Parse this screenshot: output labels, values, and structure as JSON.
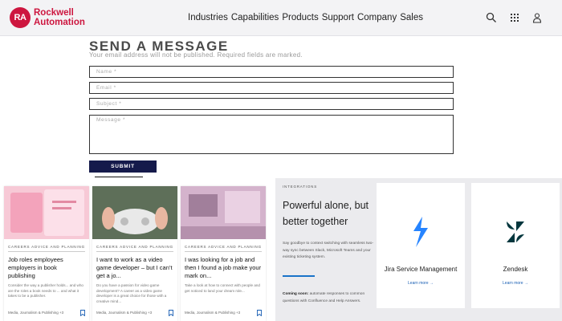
{
  "header": {
    "logo_mark": "RA",
    "logo_line1": "Rockwell",
    "logo_line2": "Automation",
    "nav": [
      "Industries",
      "Capabilities",
      "Products",
      "Support",
      "Company",
      "Sales"
    ],
    "icons": [
      "search-icon",
      "apps-grid-icon",
      "user-icon"
    ]
  },
  "form": {
    "title": "SEND A MESSAGE",
    "note": "Your email address will not be published. Required fields are marked.",
    "name_placeholder": "Name *",
    "email_placeholder": "Email *",
    "subject_placeholder": "Subject *",
    "message_placeholder": "Message *",
    "submit_label": "SUBMIT"
  },
  "cards": [
    {
      "category": "CAREERS ADVICE AND PLANNING",
      "title": "Job roles employees employers in book publishing",
      "desc": "Consider the way a publisher holds... and who are the roles a book needs to ... and what it takes to be a publisher.",
      "meta": "Media, Journalism & Publishing +3",
      "thumb_color": "#f4b6c8"
    },
    {
      "category": "CAREERS ADVICE AND PLANNING",
      "title": "I want to work as a video game developer – but I can’t get a jo...",
      "desc": "Do you have a passion for video game development? A career as a video game developer is a great choice for those with a creative mind...",
      "meta": "Media, Journalism & Publishing +3",
      "thumb_color": "#2a8a3a"
    },
    {
      "category": "CAREERS ADVICE AND PLANNING",
      "title": "I was looking for a job and then I found a job make your mark on...",
      "desc": "Take a look at how to connect with people and get noticed to land your dream role...",
      "meta": "Media, Journalism & Publishing +3",
      "thumb_color": "#c9a4c0"
    }
  ],
  "integrations": {
    "label": "INTEGRATIONS",
    "title": "Powerful alone, but better together",
    "desc": "Say goodbye to context switching with seamless two-way sync between Slack, Microsoft Teams and your existing ticketing system.",
    "coming_bold": "Coming soon:",
    "coming_rest": " automate responses to common questions with Confluence and Help Answers.",
    "items": [
      {
        "name": "Jira Service Management",
        "link": "Learn more →",
        "icon": "jira-service-management-icon",
        "color": "#2684ff"
      },
      {
        "name": "Zendesk",
        "link": "Learn more →",
        "icon": "zendesk-icon",
        "color": "#03363d"
      }
    ]
  }
}
